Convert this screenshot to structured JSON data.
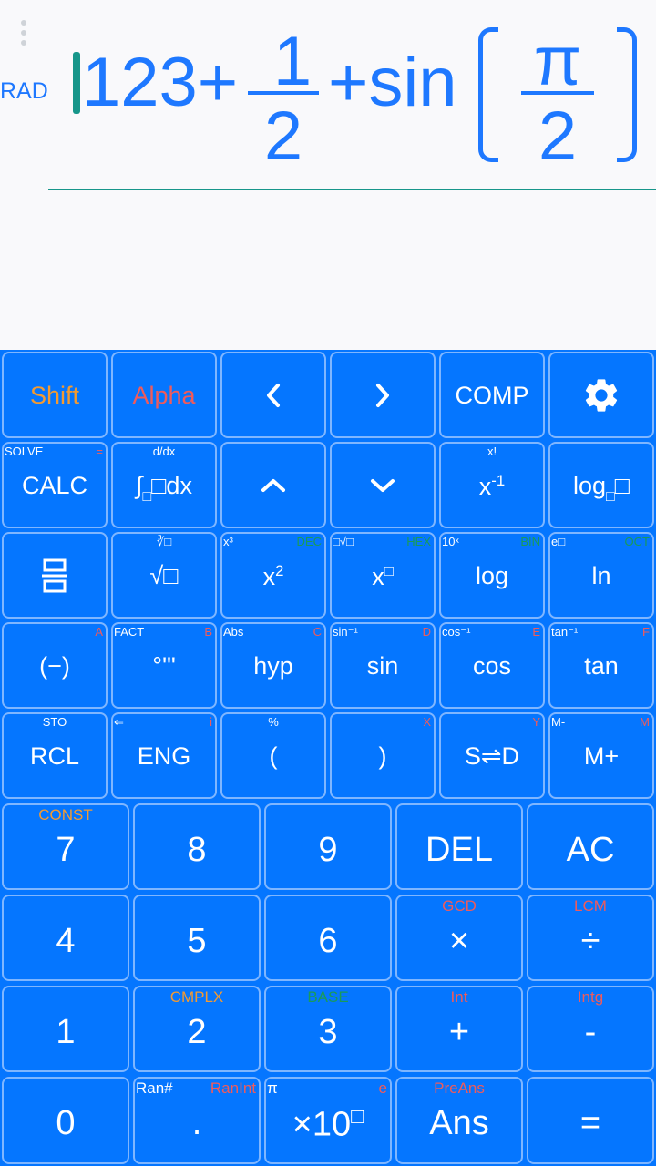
{
  "display": {
    "mode": "RAD",
    "expression": {
      "n1": "123+",
      "frac1_num": "1",
      "frac1_den": "2",
      "plus_sin": "+sin",
      "frac2_num": "π",
      "frac2_den": "2"
    }
  },
  "keys": {
    "shift": "Shift",
    "alpha": "Alpha",
    "comp": "COMP",
    "calc": "CALC",
    "calc_top": "SOLVE",
    "calc_right": "=",
    "integral": "∫",
    "integral_tail": "dx",
    "integral_top": "d/dx",
    "inv": "x",
    "inv_sup": "-1",
    "inv_top": "x!",
    "logb": "log",
    "frac_sup_top": "∛□",
    "frac_sup_right": "",
    "sqrt": "√□",
    "sqrt_top": "∛□",
    "sqrt_left": "x³",
    "sq": "x",
    "sq_sup": "2",
    "sq_left": "x³",
    "sq_right": "DEC",
    "pow": "x",
    "pow_sup": "□",
    "pow_left": "□√□",
    "pow_right": "HEX",
    "log": "log",
    "log_left": "10ˣ",
    "log_right": "BIN",
    "ln": "ln",
    "ln_left": "e□",
    "ln_right": "OCT",
    "neg": "(−)",
    "neg_right": "A",
    "deg": "°'\"",
    "deg_left": "FACT",
    "deg_right": "B",
    "hyp": "hyp",
    "hyp_left": "Abs",
    "hyp_right": "C",
    "sin": "sin",
    "sin_left": "sin⁻¹",
    "sin_right": "D",
    "cos": "cos",
    "cos_left": "cos⁻¹",
    "cos_right": "E",
    "tan": "tan",
    "tan_left": "tan⁻¹",
    "tan_right": "F",
    "rcl": "RCL",
    "rcl_top": "STO",
    "eng": "ENG",
    "eng_left": "⇐",
    "eng_right": "i",
    "lparen": "(",
    "lparen_top": "%",
    "rparen": ")",
    "rparen_right": "X",
    "sd": "S⇌D",
    "sd_right": "Y",
    "mplus": "M+",
    "mplus_left": "M-",
    "mplus_right": "M",
    "n7": "7",
    "n7_top": "CONST",
    "n8": "8",
    "n9": "9",
    "del": "DEL",
    "ac": "AC",
    "n4": "4",
    "n5": "5",
    "n6": "6",
    "mul": "×",
    "mul_top": "GCD",
    "div": "÷",
    "div_top": "LCM",
    "n1": "1",
    "n2": "2",
    "n2_top": "CMPLX",
    "n3": "3",
    "n3_top": "BASE",
    "plus": "+",
    "plus_top": "Int",
    "minus": "-",
    "minus_top": "Intg",
    "n0": "0",
    "dot": ".",
    "dot_left": "Ran#",
    "dot_right": "RanInt",
    "exp": "×10",
    "exp_sup": "□",
    "exp_left": "π",
    "exp_right": "e",
    "ans": "Ans",
    "ans_top": "PreAns",
    "eq": "="
  },
  "colors": {
    "accent": "#1e78ff",
    "keypad_bg": "#0576ff",
    "shift_color": "#f29a32",
    "alpha_color": "#f05b5b",
    "base_color": "#1a9a5a",
    "cursor": "#17968a"
  }
}
